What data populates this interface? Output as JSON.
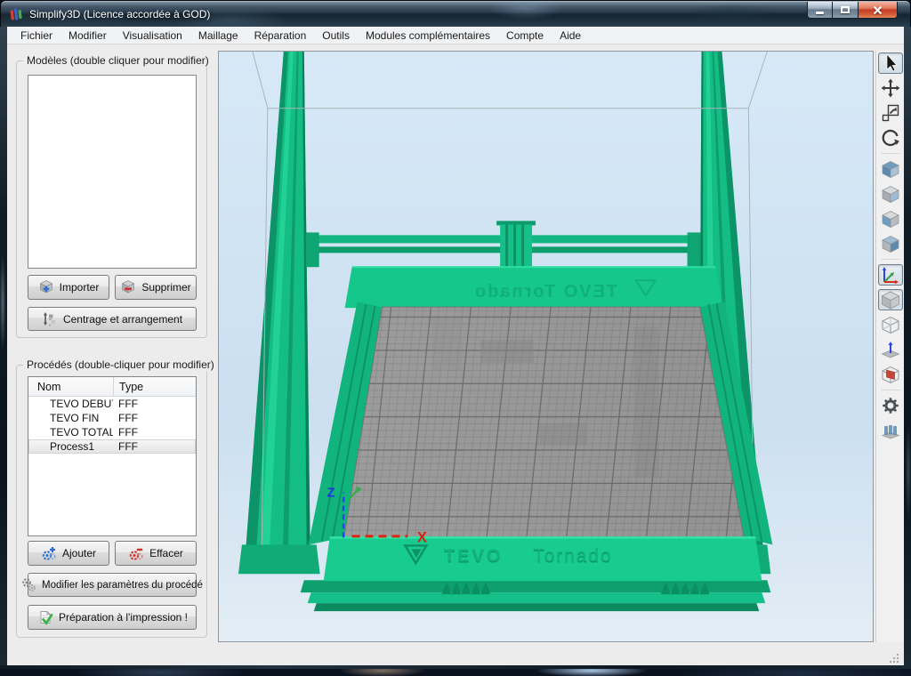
{
  "window": {
    "title": "Simplify3D (Licence accordée à GOD)"
  },
  "menu": {
    "items": [
      "Fichier",
      "Modifier",
      "Visualisation",
      "Maillage",
      "Réparation",
      "Outils",
      "Modules complémentaires",
      "Compte",
      "Aide"
    ]
  },
  "models_panel": {
    "label": "Modèles (double cliquer pour modifier)",
    "list_items": [],
    "import_label": "Importer",
    "delete_label": "Supprimer",
    "center_label": "Centrage et arrangement"
  },
  "processes_panel": {
    "label": "Procédés (double-cliquer pour modifier)",
    "table": {
      "columns": {
        "name": "Nom",
        "type": "Type"
      },
      "rows": [
        {
          "name": "TEVO DEBUT",
          "type": "FFF",
          "selected": false
        },
        {
          "name": "TEVO FIN",
          "type": "FFF",
          "selected": false
        },
        {
          "name": "TEVO TOTAL",
          "type": "FFF",
          "selected": false
        },
        {
          "name": "Process1",
          "type": "FFF",
          "selected": true
        }
      ]
    },
    "add_label": "Ajouter",
    "erase_label": "Effacer",
    "edit_label": "Modifier les paramètres du procédé",
    "prepare_label": "Préparation à l'impression !"
  },
  "viewport": {
    "front_rail_brand": "TEVO",
    "front_rail_model": "Tornado",
    "back_rail_text": "TEVO Tornado",
    "axis": {
      "z": "Z",
      "x": "X"
    },
    "colors": {
      "frame_green": "#17c78c",
      "frame_green_dark": "#0c9468",
      "bed_gray": "#9c9c9c",
      "sky_top": "#d7e9f7",
      "sky_bottom": "#e3edf5",
      "axis_z_blue": "#2a46e6",
      "axis_x_red": "#df2412",
      "axis_y_green": "#2fae4f"
    }
  },
  "toolbar": {
    "tools": [
      {
        "name": "select-tool",
        "selected": true
      },
      {
        "name": "move-tool",
        "selected": false
      },
      {
        "name": "scale-tool",
        "selected": false
      },
      {
        "name": "rotate-tool",
        "selected": false
      },
      {
        "name": "view-iso-cube",
        "selected": false
      },
      {
        "name": "view-side-cube",
        "selected": false
      },
      {
        "name": "view-front-cube",
        "selected": false
      },
      {
        "name": "view-bottom-cube",
        "selected": false
      },
      {
        "name": "axes-toggle",
        "selected": true
      },
      {
        "name": "solid-view-toggle",
        "selected": true
      },
      {
        "name": "wireframe-view-toggle",
        "selected": false
      },
      {
        "name": "normals-view-toggle",
        "selected": false
      },
      {
        "name": "cross-section-tool",
        "selected": false
      },
      {
        "name": "machine-settings",
        "selected": false
      },
      {
        "name": "support-structures-tool",
        "selected": false
      }
    ]
  },
  "icons": {
    "buttons": [
      "import-cube-plus-icon",
      "delete-cube-minus-icon",
      "center-arrange-icon",
      "add-gear-plus-icon",
      "erase-gear-minus-icon",
      "edit-gears-icon",
      "prepare-print-check-icon"
    ],
    "window": [
      "minimize-icon",
      "maximize-icon",
      "close-icon"
    ]
  }
}
